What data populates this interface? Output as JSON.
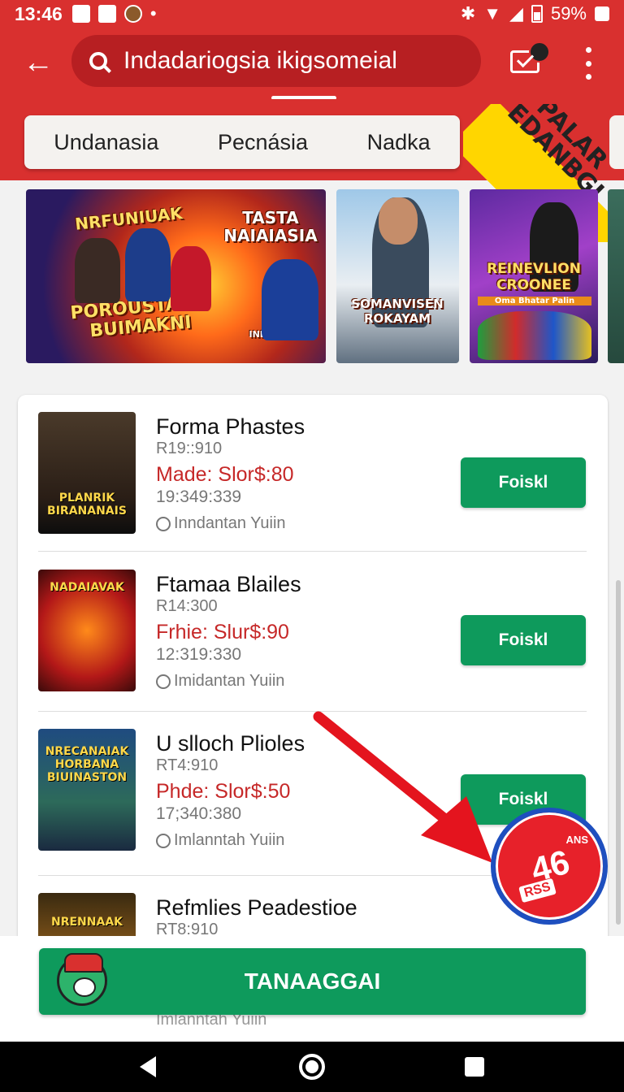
{
  "status": {
    "time": "13:46",
    "battery": "59%"
  },
  "header": {
    "search_query": "Indadariogsia ikigsomeial"
  },
  "tabs": [
    "Undanasia",
    "Pecnásia",
    "Nadka"
  ],
  "promo": {
    "text": "PALAR EDANBGI"
  },
  "banners": [
    {
      "top": "NRFUNIUAK",
      "main": "POROUSTAILY BUIMAKNI",
      "sub": "TASTA NAIAIASIA",
      "note": "INDONESIA"
    },
    {
      "main": "SOMANVISEN ROKAYAM"
    },
    {
      "main": "REINEVLION CROONEE",
      "sub": "Oma Bhatar Palin"
    }
  ],
  "list": [
    {
      "title": "Forma Phastes",
      "code": "R19::910",
      "price": "Made: Slor$:80",
      "meta": "19:349:339",
      "location": "Inndantan Yuiin",
      "button": "Foiskl",
      "thumb_text": "PLANRIK BIRANANAIS"
    },
    {
      "title": "Ftamaa Blailes",
      "code": "R14:300",
      "price": "Frhie: Slur$:90",
      "meta": "12:319:330",
      "location": "Imidantan Yuiin",
      "button": "Foiskl",
      "thumb_text": "NADAIAVAK"
    },
    {
      "title": "U slloch Plioles",
      "code": "RT4:910",
      "price": "Phde: Slor$:50",
      "meta": "17;340:380",
      "location": "Imlanntah Yuiin",
      "button": "Foiskl",
      "thumb_text": "NRECANAIAK HORBANA BIUINASTON"
    },
    {
      "title": "Refmlies Peadestioe",
      "code": "RT8:910",
      "thumb_text": "NRENNAAK"
    }
  ],
  "cta": {
    "label": "TANAAGGAI",
    "behind_text": "Imlanntah Yuiin"
  },
  "badge": {
    "number": "46",
    "small": "ANS",
    "tag": "RSS"
  },
  "colors": {
    "brand_red": "#d9302f",
    "action_green": "#0e9a5c",
    "price_red": "#c62828"
  }
}
